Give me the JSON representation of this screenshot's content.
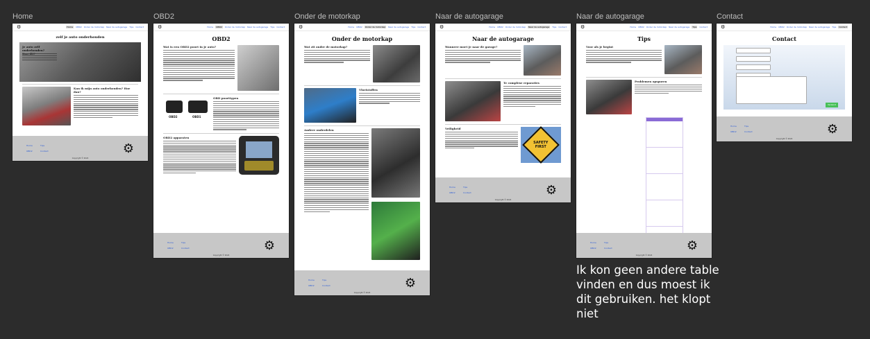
{
  "frames": [
    {
      "label": "Home"
    },
    {
      "label": "OBD2"
    },
    {
      "label": "Onder de motorkap"
    },
    {
      "label": "Naar de autogarage"
    },
    {
      "label": "Naar de autogarage"
    },
    {
      "label": "Contact"
    }
  ],
  "nav_links": [
    "Home",
    "OBD2",
    "Onder de motorkap",
    "Naar de autogarage",
    "Tips",
    "Contact"
  ],
  "logo_icon": "car-parts-logo-icon",
  "pages": {
    "home": {
      "title": "zelf je auto onderhouden",
      "section1": "Je auto zelf onderhouden? Kan dit?",
      "section2": "Kan ik mijn auto onderhouden? Hoe dan?"
    },
    "obd2": {
      "title": "OBD2",
      "section1": "Wat is een OBD2 poort in je auto?",
      "section2": "OBD poorttypen",
      "section3": "OBD2 apparaten",
      "connector_a": "OBD2",
      "connector_b": "OBD1"
    },
    "motorkap": {
      "title": "Onder de motorkap",
      "section1": "Wat zit onder de motorkap?",
      "section2": "Vloeistoffen",
      "section3": "Andere onderdelen"
    },
    "garage": {
      "title": "Naar de autogarage",
      "section1": "Wanneer moet je naar de garage?",
      "section2": "Te complexe reparaties",
      "section3": "Veiligheid",
      "safety_sign_line1": "SAFETY",
      "safety_sign_line2": "FIRST"
    },
    "tips": {
      "title": "Tips",
      "section1": "Voor als je begint",
      "section2": "Problemen opsporen"
    },
    "contact": {
      "title": "Contact",
      "send_label": "Verzend"
    }
  },
  "footer": {
    "copyright": "Copyright © 2024"
  },
  "comment_text": "Ik kon geen andere table vinden en dus moest ik dit gebruiken. het klopt niet"
}
